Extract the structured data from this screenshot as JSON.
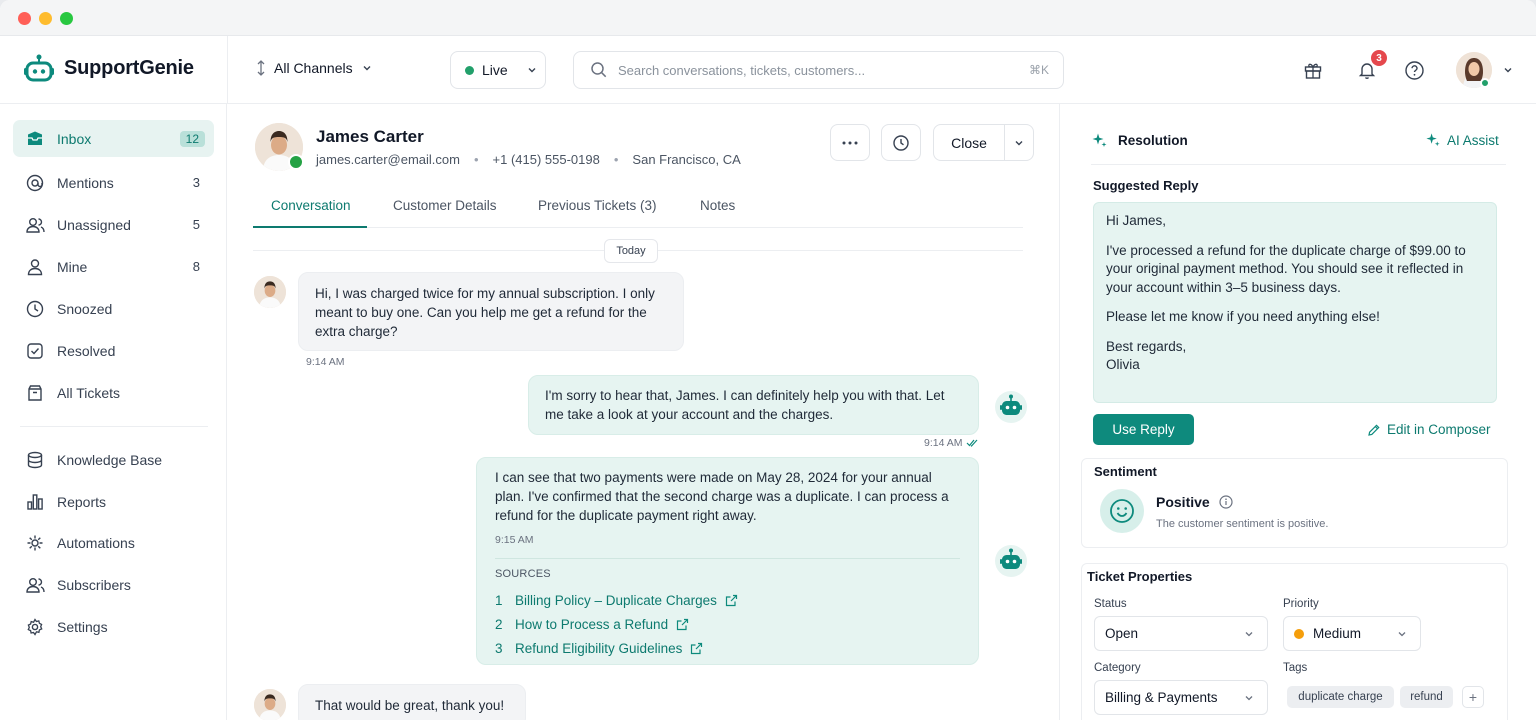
{
  "app": {
    "name": "SupportGenie"
  },
  "header": {
    "channel": "All Channels",
    "status": "Live",
    "search_placeholder": "Search conversations, tickets, customers...",
    "search_shortcut": "⌘K",
    "notification_count": "3"
  },
  "sidebar": {
    "items": [
      {
        "label": "Inbox",
        "count": "12",
        "icon": "inbox-icon",
        "active": true
      },
      {
        "label": "Mentions",
        "count": "3",
        "icon": "at-icon"
      },
      {
        "label": "Unassigned",
        "count": "5",
        "icon": "users-icon"
      },
      {
        "label": "Mine",
        "count": "8",
        "icon": "user-icon"
      },
      {
        "label": "Snoozed",
        "count": "",
        "icon": "clock-icon"
      },
      {
        "label": "Resolved",
        "count": "",
        "icon": "check-square-icon"
      },
      {
        "label": "All Tickets",
        "count": "",
        "icon": "archive-icon"
      }
    ],
    "secondary": [
      {
        "label": "Knowledge Base",
        "icon": "database-icon"
      },
      {
        "label": "Reports",
        "icon": "bar-chart-icon"
      },
      {
        "label": "Automations",
        "icon": "automation-icon"
      },
      {
        "label": "Subscribers",
        "icon": "subscribers-icon"
      },
      {
        "label": "Settings",
        "icon": "gear-icon"
      }
    ]
  },
  "customer": {
    "name": "James Carter",
    "email": "james.carter@email.com",
    "phone": "+1 (415) 555-0198",
    "location": "San Francisco, CA"
  },
  "actions": {
    "close_label": "Close"
  },
  "tabs": [
    "Conversation",
    "Customer Details",
    "Previous Tickets (3)",
    "Notes"
  ],
  "conversation": {
    "date_label": "Today",
    "messages": [
      {
        "from": "customer",
        "text": "Hi, I was charged twice for my annual subscription. I only meant to buy one. Can you help me get a refund for the extra charge?",
        "time": "9:14 AM"
      },
      {
        "from": "bot",
        "text": "I'm sorry to hear that, James. I can definitely help you with that. Let me take a look at your account and the charges.",
        "time": "9:14 AM"
      },
      {
        "from": "bot",
        "text": "I can see that two payments were made on May 28, 2024 for your annual plan. I've confirmed that the second charge was a duplicate. I can process a refund for the duplicate payment right away.",
        "time": "9:15 AM",
        "sources_title": "SOURCES",
        "sources": [
          {
            "n": "1",
            "title": "Billing Policy – Duplicate Charges"
          },
          {
            "n": "2",
            "title": "How to Process a Refund"
          },
          {
            "n": "3",
            "title": "Refund Eligibility Guidelines"
          }
        ]
      },
      {
        "from": "customer",
        "text": "That would be great, thank you!",
        "time": ""
      }
    ]
  },
  "resolution": {
    "title": "Resolution",
    "ai_assist": "AI Assist",
    "suggested_title": "Suggested Reply",
    "reply": {
      "greeting": "Hi James,",
      "body": "I've processed a refund for the duplicate charge of $99.00 to your original payment method. You should see it reflected in your account within 3–5 business days.",
      "closing": "Please let me know if you need anything else!",
      "signoff": "Best regards,",
      "signature": "Olivia"
    },
    "use_reply": "Use Reply",
    "edit_composer": "Edit in Composer"
  },
  "sentiment": {
    "title": "Sentiment",
    "label": "Positive",
    "description": "The customer sentiment is positive."
  },
  "properties": {
    "title": "Ticket Properties",
    "status_label": "Status",
    "status": "Open",
    "priority_label": "Priority",
    "priority": "Medium",
    "category_label": "Category",
    "category": "Billing & Payments",
    "tags_label": "Tags",
    "tags": [
      "duplicate charge",
      "refund"
    ]
  },
  "colors": {
    "accent": "#0d7a6f",
    "accent_button": "#0e8a7d",
    "live": "#22a06b",
    "priority_medium": "#f59e0b",
    "badge": "#e5484d"
  }
}
